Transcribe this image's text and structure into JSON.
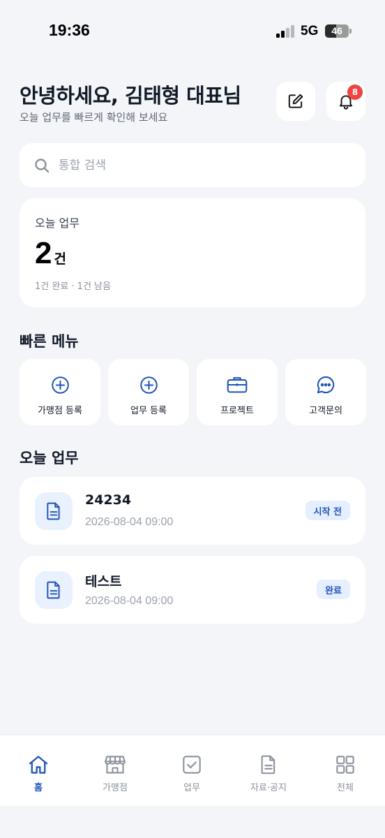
{
  "status_bar": {
    "time": "19:36",
    "network": "5G",
    "battery": "46",
    "battery_level": 0.46
  },
  "header": {
    "greeting": "안녕하세요, 김태형 대표님",
    "subtitle": "오늘 업무를 빠르게 확인해 보세요",
    "notification_count": "8"
  },
  "search": {
    "placeholder": "통합 검색",
    "value": ""
  },
  "summary": {
    "label": "오늘 업무",
    "count": "2",
    "unit": "건",
    "detail": "1건 완료 · 1건 남음"
  },
  "quick_menu": {
    "title": "빠른 메뉴",
    "items": [
      {
        "label": "가맹점 등록",
        "icon": "plus-circle-icon"
      },
      {
        "label": "업무 등록",
        "icon": "plus-circle-icon"
      },
      {
        "label": "프로젝트",
        "icon": "briefcase-icon"
      },
      {
        "label": "고객문의",
        "icon": "chat-bubble-icon"
      }
    ]
  },
  "tasks": {
    "title": "오늘 업무",
    "items": [
      {
        "title": "24234",
        "date": "2026-08-04 09:00",
        "status": "시작 전",
        "icon": "document-icon"
      },
      {
        "title": "테스트",
        "date": "2026-08-04 09:00",
        "status": "완료",
        "icon": "document-icon"
      }
    ]
  },
  "bottom_nav": {
    "items": [
      {
        "label": "홈",
        "icon": "home-icon",
        "active": true
      },
      {
        "label": "가맹점",
        "icon": "store-icon",
        "active": false
      },
      {
        "label": "업무",
        "icon": "checkbox-icon",
        "active": false
      },
      {
        "label": "자료·공지",
        "icon": "document-icon",
        "active": false
      },
      {
        "label": "전체",
        "icon": "grid-icon",
        "active": false
      }
    ]
  },
  "colors": {
    "accent": "#1f55b8",
    "background": "#f3f5f9",
    "badge": "#ef4444",
    "icon_bg": "#e8f1fd"
  }
}
